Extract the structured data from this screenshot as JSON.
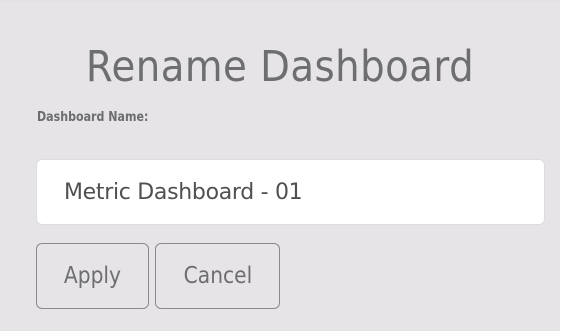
{
  "dialog": {
    "title": "Rename Dashboard",
    "field_label": "Dashboard Name:",
    "name_value": "Metric Dashboard - 01",
    "buttons": {
      "apply_label": "Apply",
      "cancel_label": "Cancel"
    }
  },
  "colors": {
    "dialog_background": "#e6e4e7",
    "title_text": "#6e6e70",
    "input_background": "#ffffff",
    "button_border": "#8b8a8c"
  }
}
